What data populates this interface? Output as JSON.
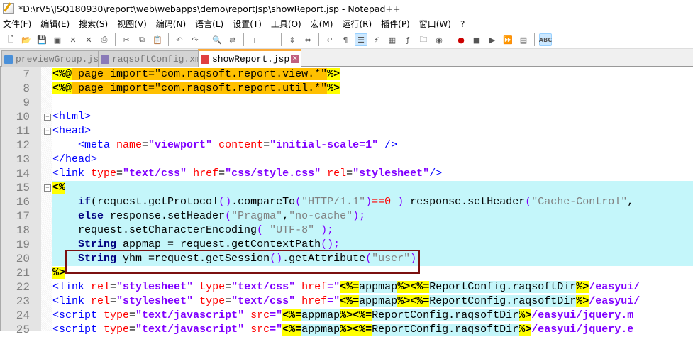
{
  "title": "*D:\\rV5\\JSQ180930\\report\\web\\webapps\\demo\\reportJsp\\showReport.jsp - Notepad++",
  "menu": [
    "文件(F)",
    "编辑(E)",
    "搜索(S)",
    "视图(V)",
    "编码(N)",
    "语言(L)",
    "设置(T)",
    "工具(O)",
    "宏(M)",
    "运行(R)",
    "插件(P)",
    "窗口(W)",
    "?"
  ],
  "toolbar": [
    "new",
    "open",
    "save",
    "save-all",
    "close",
    "close-all",
    "print",
    "|",
    "cut",
    "copy",
    "paste",
    "|",
    "undo",
    "redo",
    "|",
    "find",
    "replace",
    "|",
    "zoom-in",
    "zoom-out",
    "|",
    "sync-v",
    "sync-h",
    "|",
    "wrap",
    "show-all",
    "indent-guide",
    "udl",
    "doc-map",
    "func-list",
    "folder",
    "monitor",
    "|",
    "record",
    "stop",
    "play",
    "play-multi",
    "save-macro",
    "|",
    "spellcheck"
  ],
  "tabs": [
    {
      "label": "previewGroup.jsp",
      "color": "#4a90d9",
      "active": false
    },
    {
      "label": "raqsoftConfig.xml",
      "color": "#8a7ab8",
      "active": false
    },
    {
      "label": "showReport.jsp",
      "color": "#e04040",
      "active": true
    }
  ],
  "lines": [
    {
      "n": "7",
      "bg": "",
      "tk": [
        [
          "<%@",
          "dl"
        ],
        [
          " page import=\"com.raqsoft.report.view.*\"",
          "dir"
        ],
        [
          "%>",
          "dl"
        ]
      ]
    },
    {
      "n": "8",
      "bg": "",
      "tk": [
        [
          "<%@",
          "dl"
        ],
        [
          " page import=\"com.raqsoft.report.util.*\"",
          "dir"
        ],
        [
          "%>",
          "dl"
        ]
      ]
    },
    {
      "n": "9",
      "bg": "",
      "tk": []
    },
    {
      "n": "10",
      "bg": "",
      "fold": "-",
      "tk": [
        [
          "<html>",
          "tag"
        ]
      ]
    },
    {
      "n": "11",
      "bg": "",
      "fold": "-",
      "tk": [
        [
          "<head>",
          "tag"
        ]
      ]
    },
    {
      "n": "12",
      "bg": "",
      "tk": [
        [
          "    <meta ",
          "tag"
        ],
        [
          "name",
          "attr"
        ],
        [
          "=",
          "eq"
        ],
        [
          "\"viewport\"",
          "str"
        ],
        [
          " content",
          "attr"
        ],
        [
          "=",
          "eq"
        ],
        [
          "\"initial-scale=1\"",
          "str"
        ],
        [
          " />",
          "tag"
        ]
      ]
    },
    {
      "n": "13",
      "bg": "",
      "tk": [
        [
          "</head>",
          "tag"
        ]
      ]
    },
    {
      "n": "14",
      "bg": "",
      "tk": [
        [
          "<link ",
          "tag"
        ],
        [
          "type",
          "attr"
        ],
        [
          "=",
          "eq"
        ],
        [
          "\"text/css\"",
          "str"
        ],
        [
          " href",
          "attr"
        ],
        [
          "=",
          "eq"
        ],
        [
          "\"css/style.css\"",
          "str"
        ],
        [
          " rel",
          "attr"
        ],
        [
          "=",
          "eq"
        ],
        [
          "\"stylesheet\"",
          "str"
        ],
        [
          "/>",
          "tag"
        ]
      ]
    },
    {
      "n": "15",
      "bg": "cy",
      "fold": "-",
      "tk": [
        [
          "<%",
          "dl"
        ]
      ]
    },
    {
      "n": "16",
      "bg": "cy",
      "tk": [
        [
          "    ",
          "plain"
        ],
        [
          "if",
          "kw"
        ],
        [
          "(request.getProtocol",
          "plain"
        ],
        [
          "()",
          "p"
        ],
        [
          ".compareTo",
          "plain"
        ],
        [
          "(",
          "p"
        ],
        [
          "\"HTTP/1.1\"",
          "js"
        ],
        [
          ")",
          "p"
        ],
        [
          "==0",
          "num"
        ],
        [
          " ) ",
          "p"
        ],
        [
          "response.setHeader",
          "plain"
        ],
        [
          "(",
          "p"
        ],
        [
          "\"Cache-Control\"",
          "js"
        ],
        [
          ",",
          "plain"
        ]
      ]
    },
    {
      "n": "17",
      "bg": "cy",
      "tk": [
        [
          "    ",
          "plain"
        ],
        [
          "else",
          "kw"
        ],
        [
          " response.setHeader",
          "plain"
        ],
        [
          "(",
          "p"
        ],
        [
          "\"Pragma\"",
          "js"
        ],
        [
          ",",
          "plain"
        ],
        [
          "\"no-cache\"",
          "js"
        ],
        [
          ");",
          "p"
        ]
      ]
    },
    {
      "n": "18",
      "bg": "cy",
      "tk": [
        [
          "    request.setCharacterEncoding",
          "plain"
        ],
        [
          "( ",
          "p"
        ],
        [
          "\"UTF-8\"",
          "js"
        ],
        [
          " );",
          "p"
        ]
      ]
    },
    {
      "n": "19",
      "bg": "cy",
      "tk": [
        [
          "    ",
          "plain"
        ],
        [
          "String",
          "kw"
        ],
        [
          " appmap = request.getContextPath",
          "plain"
        ],
        [
          "();",
          "p"
        ]
      ]
    },
    {
      "n": "20",
      "bg": "cy",
      "tk": [
        [
          "    ",
          "plain"
        ],
        [
          "String",
          "kw"
        ],
        [
          " yhm =request.getSession",
          "plain"
        ],
        [
          "()",
          "p"
        ],
        [
          ".getAttribute",
          "plain"
        ],
        [
          "(",
          "p"
        ],
        [
          "\"user\"",
          "js"
        ],
        [
          ")",
          "p"
        ]
      ]
    },
    {
      "n": "21",
      "bg": "",
      "tk": [
        [
          "%>",
          "dl"
        ]
      ]
    },
    {
      "n": "22",
      "bg": "",
      "tk": [
        [
          "<link ",
          "tag"
        ],
        [
          "rel",
          "attr"
        ],
        [
          "=",
          "eq"
        ],
        [
          "\"stylesheet\"",
          "str"
        ],
        [
          " type",
          "attr"
        ],
        [
          "=",
          "eq"
        ],
        [
          "\"text/css\"",
          "str"
        ],
        [
          " href",
          "attr"
        ],
        [
          "=\"",
          "str"
        ],
        [
          "<%=",
          "dl"
        ],
        [
          "appmap",
          "java"
        ],
        [
          "%><%=",
          "dl"
        ],
        [
          "ReportConfig.raqsoftDir",
          "java"
        ],
        [
          "%>",
          "dl"
        ],
        [
          "/easyui/",
          "str"
        ]
      ]
    },
    {
      "n": "23",
      "bg": "",
      "tk": [
        [
          "<link ",
          "tag"
        ],
        [
          "rel",
          "attr"
        ],
        [
          "=",
          "eq"
        ],
        [
          "\"stylesheet\"",
          "str"
        ],
        [
          " type",
          "attr"
        ],
        [
          "=",
          "eq"
        ],
        [
          "\"text/css\"",
          "str"
        ],
        [
          " href",
          "attr"
        ],
        [
          "=\"",
          "str"
        ],
        [
          "<%=",
          "dl"
        ],
        [
          "appmap",
          "java"
        ],
        [
          "%><%=",
          "dl"
        ],
        [
          "ReportConfig.raqsoftDir",
          "java"
        ],
        [
          "%>",
          "dl"
        ],
        [
          "/easyui/",
          "str"
        ]
      ]
    },
    {
      "n": "24",
      "bg": "",
      "tk": [
        [
          "<script ",
          "tag"
        ],
        [
          "type",
          "attr"
        ],
        [
          "=",
          "eq"
        ],
        [
          "\"text/javascript\"",
          "str"
        ],
        [
          " src",
          "attr"
        ],
        [
          "=\"",
          "str"
        ],
        [
          "<%=",
          "dl"
        ],
        [
          "appmap",
          "java"
        ],
        [
          "%><%=",
          "dl"
        ],
        [
          "ReportConfig.raqsoftDir",
          "java"
        ],
        [
          "%>",
          "dl"
        ],
        [
          "/easyui/jquery.m",
          "str"
        ]
      ]
    },
    {
      "n": "25",
      "bg": "",
      "tk": [
        [
          "<script ",
          "tag"
        ],
        [
          "type",
          "attr"
        ],
        [
          "=",
          "eq"
        ],
        [
          "\"text/javascript\"",
          "str"
        ],
        [
          " src",
          "attr"
        ],
        [
          "=\"",
          "str"
        ],
        [
          "<%=",
          "dl"
        ],
        [
          "appmap",
          "java"
        ],
        [
          "%><%=",
          "dl"
        ],
        [
          "ReportConfig.raqsoftDir",
          "java"
        ],
        [
          "%>",
          "dl"
        ],
        [
          "/easyui/jquery.e",
          "str"
        ]
      ]
    }
  ]
}
